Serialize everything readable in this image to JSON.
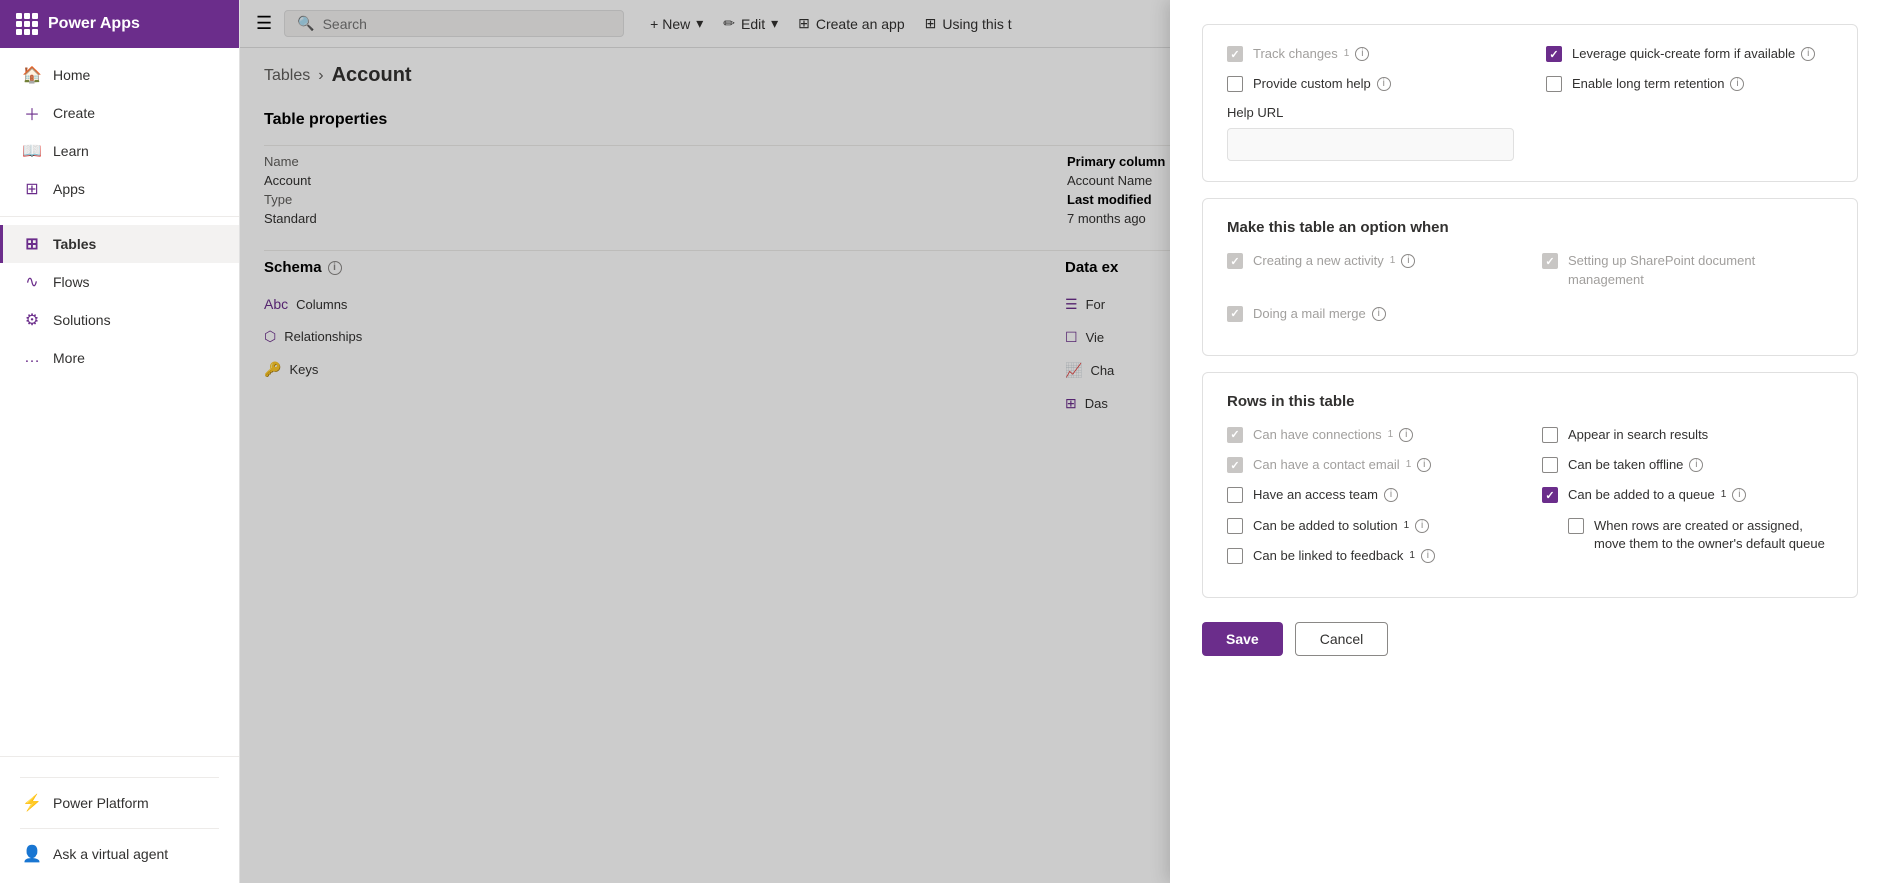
{
  "app": {
    "title": "Power Apps"
  },
  "search": {
    "placeholder": "Search"
  },
  "sidebar": {
    "items": [
      {
        "id": "home",
        "label": "Home",
        "icon": "🏠"
      },
      {
        "id": "create",
        "label": "Create",
        "icon": "+"
      },
      {
        "id": "learn",
        "label": "Learn",
        "icon": "📖"
      },
      {
        "id": "apps",
        "label": "Apps",
        "icon": "⊞"
      },
      {
        "id": "tables",
        "label": "Tables",
        "icon": "⊞",
        "active": true
      },
      {
        "id": "flows",
        "label": "Flows",
        "icon": "∿"
      },
      {
        "id": "solutions",
        "label": "Solutions",
        "icon": "⚙"
      },
      {
        "id": "more",
        "label": "More",
        "icon": "…"
      }
    ],
    "bottom": {
      "power_platform": "Power Platform",
      "ask_agent": "Ask a virtual agent"
    }
  },
  "toolbar": {
    "new_label": "+ New",
    "edit_label": "Edit",
    "create_app_label": "Create an app",
    "using_this_label": "Using this t"
  },
  "breadcrumb": {
    "parent": "Tables",
    "current": "Account"
  },
  "table_properties": {
    "section_title": "Table properties",
    "name_label": "Name",
    "name_value": "Account",
    "primary_col_label": "Primary column",
    "primary_col_value": "Account Name",
    "type_label": "Type",
    "type_value": "Standard",
    "last_modified_label": "Last modified",
    "last_modified_value": "7 months ago"
  },
  "schema": {
    "title": "Schema",
    "items": [
      {
        "label": "Columns",
        "icon": "Abc"
      },
      {
        "label": "Relationships",
        "icon": "⬡"
      },
      {
        "label": "Keys",
        "icon": "🔑"
      }
    ]
  },
  "data_exp": {
    "title": "Data ex",
    "items": [
      {
        "label": "For"
      },
      {
        "label": "Vie"
      },
      {
        "label": "Cha"
      },
      {
        "label": "Das"
      }
    ]
  },
  "panel": {
    "track_changes": {
      "label": "Track changes",
      "superscript": "1",
      "checked": true,
      "disabled": true
    },
    "provide_custom_help": {
      "label": "Provide custom help",
      "checked": false,
      "disabled": false
    },
    "help_url": {
      "label": "Help URL",
      "value": ""
    },
    "leverage_quick_create": {
      "label": "Leverage quick-create form if available",
      "checked": true,
      "disabled": false
    },
    "enable_long_term": {
      "label": "Enable long term retention",
      "checked": false,
      "disabled": false
    },
    "make_option_section": {
      "title": "Make this table an option when",
      "creating_new_activity": {
        "label": "Creating a new activity",
        "superscript": "1",
        "checked": true,
        "disabled": true
      },
      "doing_mail_merge": {
        "label": "Doing a mail merge",
        "checked": true,
        "disabled": true
      },
      "setting_up_sharepoint": {
        "label": "Setting up SharePoint document management",
        "checked": true,
        "disabled": true
      }
    },
    "rows_section": {
      "title": "Rows in this table",
      "can_have_connections": {
        "label": "Can have connections",
        "superscript": "1",
        "checked": true,
        "disabled": true
      },
      "can_have_contact_email": {
        "label": "Can have a contact email",
        "superscript": "1",
        "checked": true,
        "disabled": true
      },
      "have_access_team": {
        "label": "Have an access team",
        "checked": false,
        "disabled": false
      },
      "can_be_added_to_solution": {
        "label": "Can be added to solution",
        "superscript": "1",
        "checked": false,
        "disabled": false
      },
      "can_be_linked_to_feedback": {
        "label": "Can be linked to feedback",
        "superscript": "1",
        "checked": false,
        "disabled": false
      },
      "appear_in_search": {
        "label": "Appear in search results",
        "checked": false,
        "disabled": false
      },
      "can_be_taken_offline": {
        "label": "Can be taken offline",
        "checked": false,
        "disabled": false
      },
      "can_be_added_to_queue": {
        "label": "Can be added to a queue",
        "superscript": "1",
        "checked": true,
        "disabled": false
      },
      "when_rows_created": {
        "label": "When rows are created or assigned, move them to the owner's default queue",
        "checked": false,
        "disabled": false
      }
    },
    "save_label": "Save",
    "cancel_label": "Cancel"
  }
}
